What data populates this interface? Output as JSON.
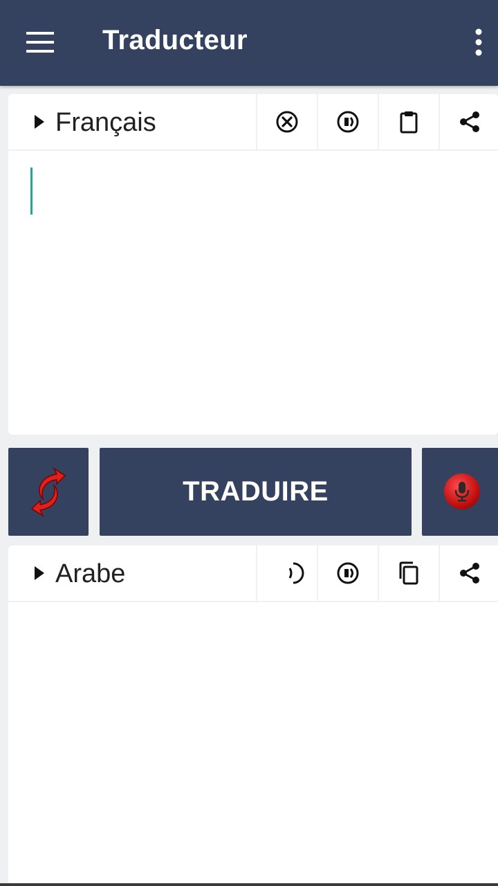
{
  "app_bar": {
    "title": "Traducteur",
    "menu_icon": "hamburger-menu-icon",
    "overflow_icon": "more-vertical-icon",
    "background": "#34425f"
  },
  "source": {
    "language": "Français",
    "text_value": "",
    "tools": [
      "clear-icon",
      "speaker-icon",
      "paste-icon",
      "share-icon"
    ]
  },
  "actions": {
    "swap_icon": "swap-arrows-icon",
    "translate_label": "TRADUIRE",
    "mic_icon": "microphone-icon",
    "accent": "#e0201a"
  },
  "target": {
    "language": "Arabe",
    "text_value": "",
    "tools": [
      "speaker-icon",
      "speaker-icon",
      "copy-icon",
      "share-icon"
    ]
  }
}
